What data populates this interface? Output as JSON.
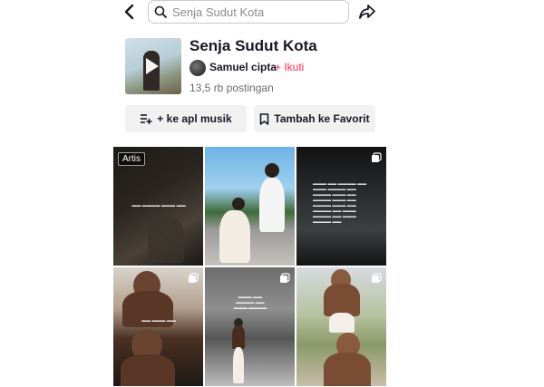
{
  "topbar": {
    "back_icon": "chevron-left-icon",
    "search_placeholder": "Senja Sudut Kota",
    "search_icon": "search-icon",
    "share_icon": "share-arrow-icon"
  },
  "header": {
    "title": "Senja Sudut Kota",
    "author": "Samuel cipta",
    "follow_label": "+ Ikuti",
    "posts_count": "13,5 rb postingan"
  },
  "actions": {
    "music_label": "+ ke apl musik",
    "favorite_label": "Tambah ke Favorit"
  },
  "grid": {
    "items": [
      {
        "badge": "Artis"
      }
    ]
  },
  "colors": {
    "accent": "#fe2c55",
    "button_bg": "#f1f1f2",
    "text": "#161823"
  }
}
